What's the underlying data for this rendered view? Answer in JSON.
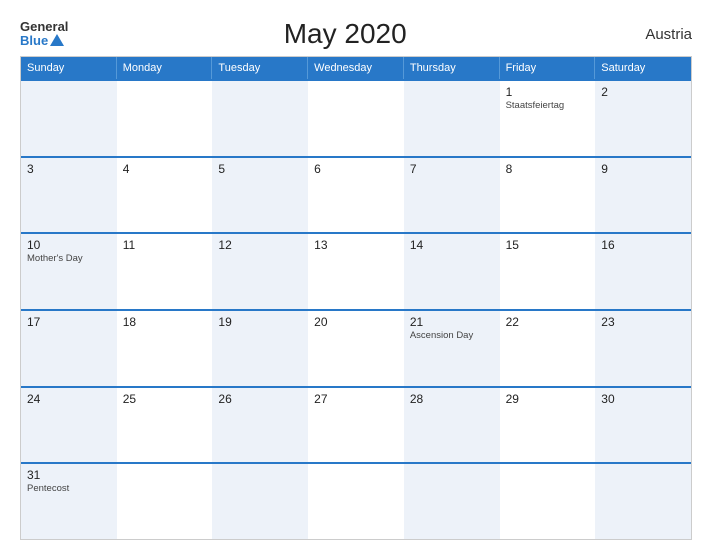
{
  "header": {
    "title": "May 2020",
    "country": "Austria",
    "logo_general": "General",
    "logo_blue": "Blue"
  },
  "weekdays": [
    "Sunday",
    "Monday",
    "Tuesday",
    "Wednesday",
    "Thursday",
    "Friday",
    "Saturday"
  ],
  "rows": [
    [
      {
        "num": "",
        "event": ""
      },
      {
        "num": "",
        "event": ""
      },
      {
        "num": "",
        "event": ""
      },
      {
        "num": "",
        "event": ""
      },
      {
        "num": "",
        "event": ""
      },
      {
        "num": "1",
        "event": "Staatsfeiertag"
      },
      {
        "num": "2",
        "event": ""
      }
    ],
    [
      {
        "num": "3",
        "event": ""
      },
      {
        "num": "4",
        "event": ""
      },
      {
        "num": "5",
        "event": ""
      },
      {
        "num": "6",
        "event": ""
      },
      {
        "num": "7",
        "event": ""
      },
      {
        "num": "8",
        "event": ""
      },
      {
        "num": "9",
        "event": ""
      }
    ],
    [
      {
        "num": "10",
        "event": "Mother's Day"
      },
      {
        "num": "11",
        "event": ""
      },
      {
        "num": "12",
        "event": ""
      },
      {
        "num": "13",
        "event": ""
      },
      {
        "num": "14",
        "event": ""
      },
      {
        "num": "15",
        "event": ""
      },
      {
        "num": "16",
        "event": ""
      }
    ],
    [
      {
        "num": "17",
        "event": ""
      },
      {
        "num": "18",
        "event": ""
      },
      {
        "num": "19",
        "event": ""
      },
      {
        "num": "20",
        "event": ""
      },
      {
        "num": "21",
        "event": "Ascension Day"
      },
      {
        "num": "22",
        "event": ""
      },
      {
        "num": "23",
        "event": ""
      }
    ],
    [
      {
        "num": "24",
        "event": ""
      },
      {
        "num": "25",
        "event": ""
      },
      {
        "num": "26",
        "event": ""
      },
      {
        "num": "27",
        "event": ""
      },
      {
        "num": "28",
        "event": ""
      },
      {
        "num": "29",
        "event": ""
      },
      {
        "num": "30",
        "event": ""
      }
    ],
    [
      {
        "num": "31",
        "event": "Pentecost"
      },
      {
        "num": "",
        "event": ""
      },
      {
        "num": "",
        "event": ""
      },
      {
        "num": "",
        "event": ""
      },
      {
        "num": "",
        "event": ""
      },
      {
        "num": "",
        "event": ""
      },
      {
        "num": "",
        "event": ""
      }
    ]
  ]
}
